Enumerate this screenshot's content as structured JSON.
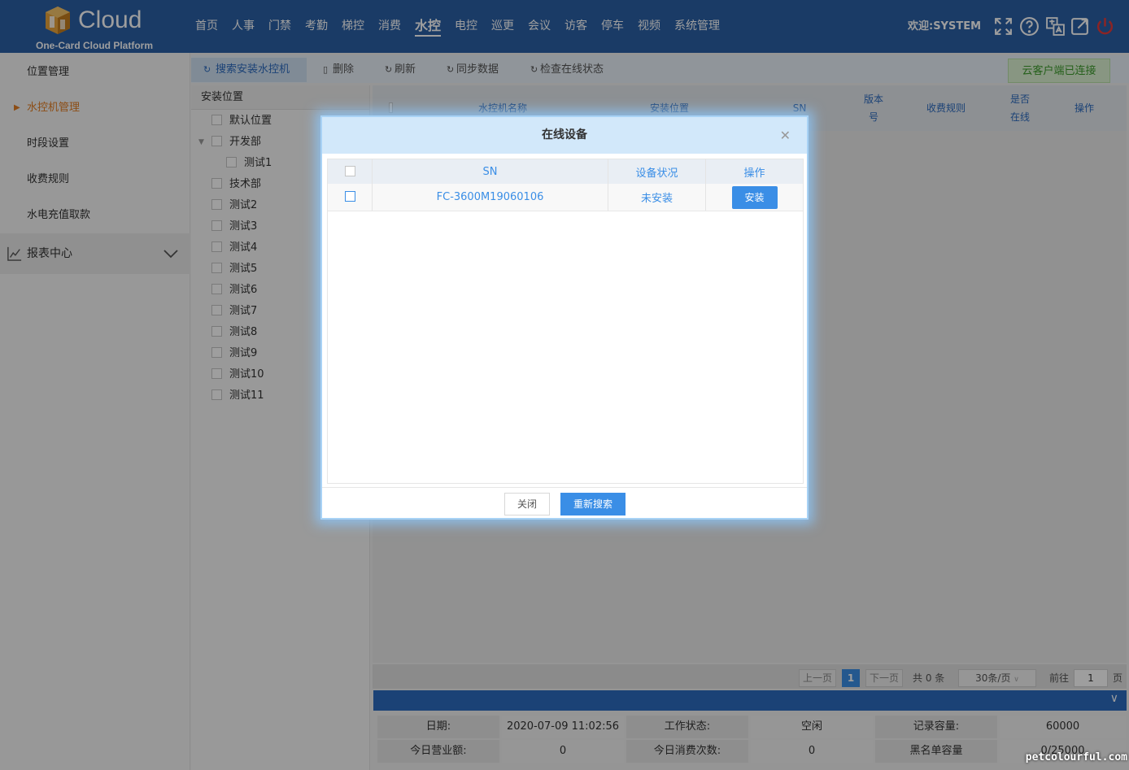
{
  "header": {
    "logo_text": "Cloud",
    "logo_subtitle": "One-Card Cloud Platform",
    "nav": [
      "首页",
      "人事",
      "门禁",
      "考勤",
      "梯控",
      "消费",
      "水控",
      "电控",
      "巡更",
      "会议",
      "访客",
      "停车",
      "视频",
      "系统管理"
    ],
    "active_nav": "水控",
    "welcome": "欢迎:SYSTEM",
    "icons": [
      "fullscreen-icon",
      "help-icon",
      "language-icon",
      "external-link-icon",
      "power-icon"
    ]
  },
  "sidebar": {
    "items": [
      "位置管理",
      "水控机管理",
      "时段设置",
      "收费规则",
      "水电充值取款"
    ],
    "active": "水控机管理",
    "section": "报表中心"
  },
  "toolbar": {
    "search_label": "搜索安装水控机",
    "delete_label": "删除",
    "refresh_label": "刷新",
    "sync_label": "同步数据",
    "check_label": "检查在线状态",
    "connection_status": "云客户端已连接"
  },
  "tree": {
    "header": "安装位置",
    "nodes": [
      "默认位置",
      "开发部",
      "测试1",
      "技术部",
      "测试2",
      "测试3",
      "测试4",
      "测试5",
      "测试6",
      "测试7",
      "测试8",
      "测试9",
      "测试10",
      "测试11"
    ]
  },
  "grid": {
    "columns": [
      "水控机名称",
      "安装位置",
      "SN",
      "版本号",
      "收费规则",
      "是否在线",
      "操作"
    ]
  },
  "pager": {
    "prev": "上一页",
    "current_page": "1",
    "next": "下一页",
    "total": "共 0 条",
    "page_size": "30条/页",
    "goto_label": "前往",
    "goto_value": "1",
    "page_unit": "页"
  },
  "info": {
    "date_label": "日期:",
    "date_value": "2020-07-09 11:02:56",
    "work_status_label": "工作状态:",
    "work_status_value": "空闲",
    "record_capacity_label": "记录容量:",
    "record_capacity_value": "60000",
    "today_revenue_label": "今日营业额:",
    "today_revenue_value": "0",
    "today_count_label": "今日消费次数:",
    "today_count_value": "0",
    "blacklist_label": "黑名单容量",
    "blacklist_value": "0/25000"
  },
  "modal": {
    "title": "在线设备",
    "columns": [
      "SN",
      "设备状况",
      "操作"
    ],
    "rows": [
      {
        "sn": "FC-3600M19060106",
        "status": "未安装",
        "action": "安装"
      }
    ],
    "close_label": "关闭",
    "research_label": "重新搜索"
  },
  "watermark": "petcolourful.com",
  "colors": {
    "header_bg": "#2b5fa5",
    "accent_orange": "#e37d22",
    "link_blue": "#3a8ee6",
    "connected_green": "#3c9b2c"
  }
}
